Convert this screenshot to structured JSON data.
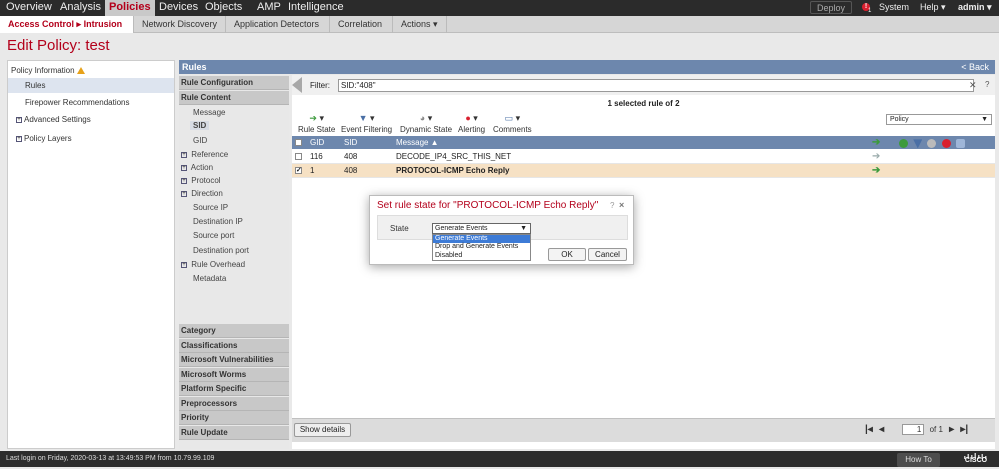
{
  "topnav": {
    "items": [
      "Overview",
      "Analysis",
      "Policies",
      "Devices",
      "Objects",
      "AMP",
      "Intelligence"
    ],
    "active": "Policies",
    "deploy_label": "Deploy",
    "alert_badge": "1",
    "system": "System",
    "help": "Help ▾",
    "user": "admin ▾"
  },
  "subnav": {
    "breadcrumb_prefix": "Access Control",
    "breadcrumb_current": "Intrusion",
    "items": [
      "Network Discovery",
      "Application Detectors",
      "Correlation",
      "Actions ▾"
    ]
  },
  "page_title": "Edit Policy: test",
  "left_panel": {
    "policy_information": "Policy Information",
    "rules": "Rules",
    "firepower_recommendations": "Firepower Recommendations",
    "advanced_settings": "Advanced Settings",
    "policy_layers": "Policy Layers"
  },
  "rules_header": {
    "title": "Rules",
    "back": "< Back"
  },
  "rules_menu": {
    "rule_configuration": "Rule Configuration",
    "rule_content": "Rule Content",
    "message": "Message",
    "sid_selected": "SID",
    "gid": "GID",
    "reference": "Reference",
    "action": "Action",
    "protocol": "Protocol",
    "direction": "Direction",
    "source_ip": "Source IP",
    "destination_ip": "Destination IP",
    "source_port": "Source port",
    "destination_port": "Destination port",
    "rule_overhead": "Rule Overhead",
    "metadata": "Metadata",
    "category": "Category",
    "classifications": "Classifications",
    "microsoft_vulnerabilities": "Microsoft Vulnerabilities",
    "microsoft_worms": "Microsoft Worms",
    "platform_specific": "Platform Specific",
    "preprocessors": "Preprocessors",
    "priority": "Priority",
    "rule_update": "Rule Update"
  },
  "filter": {
    "label": "Filter:",
    "value": "SID:\"408\"",
    "clear": "✕",
    "help": "?"
  },
  "selection_status": "1 selected rule of 2",
  "toolbar": {
    "rule_state": "Rule State",
    "event_filtering": "Event Filtering",
    "dynamic_state": "Dynamic State",
    "alerting": "Alerting",
    "comments": "Comments",
    "policy_select": "Policy"
  },
  "table": {
    "headers": {
      "gid": "GID",
      "sid": "SID",
      "message": "Message ▲"
    },
    "rows": [
      {
        "gid": "116",
        "sid": "408",
        "message": "DECODE_IP4_SRC_THIS_NET",
        "checked": false
      },
      {
        "gid": "1",
        "sid": "408",
        "message": "PROTOCOL-ICMP Echo Reply",
        "checked": true
      }
    ]
  },
  "bottom": {
    "show_details": "Show details",
    "page_value": "1",
    "page_of": "of 1"
  },
  "footer": {
    "last_login": "Last login on Friday, 2020-03-13 at 13:49:53 PM from 10.79.99.109",
    "how_to": "How To",
    "logo_text": "CISCO"
  },
  "dialog": {
    "title": "Set rule state for \"PROTOCOL-ICMP Echo Reply\"",
    "help": "?",
    "close": "×",
    "state_label": "State",
    "selected": "Generate Events",
    "options": [
      "Generate Events",
      "Drop and Generate Events",
      "Disabled"
    ],
    "ok": "OK",
    "cancel": "Cancel"
  },
  "colors": {
    "brand_red": "#b3001b",
    "header_blue": "#6d87ad",
    "selected_row": "#f6e1c4",
    "highlight": "#3d7bd6"
  }
}
